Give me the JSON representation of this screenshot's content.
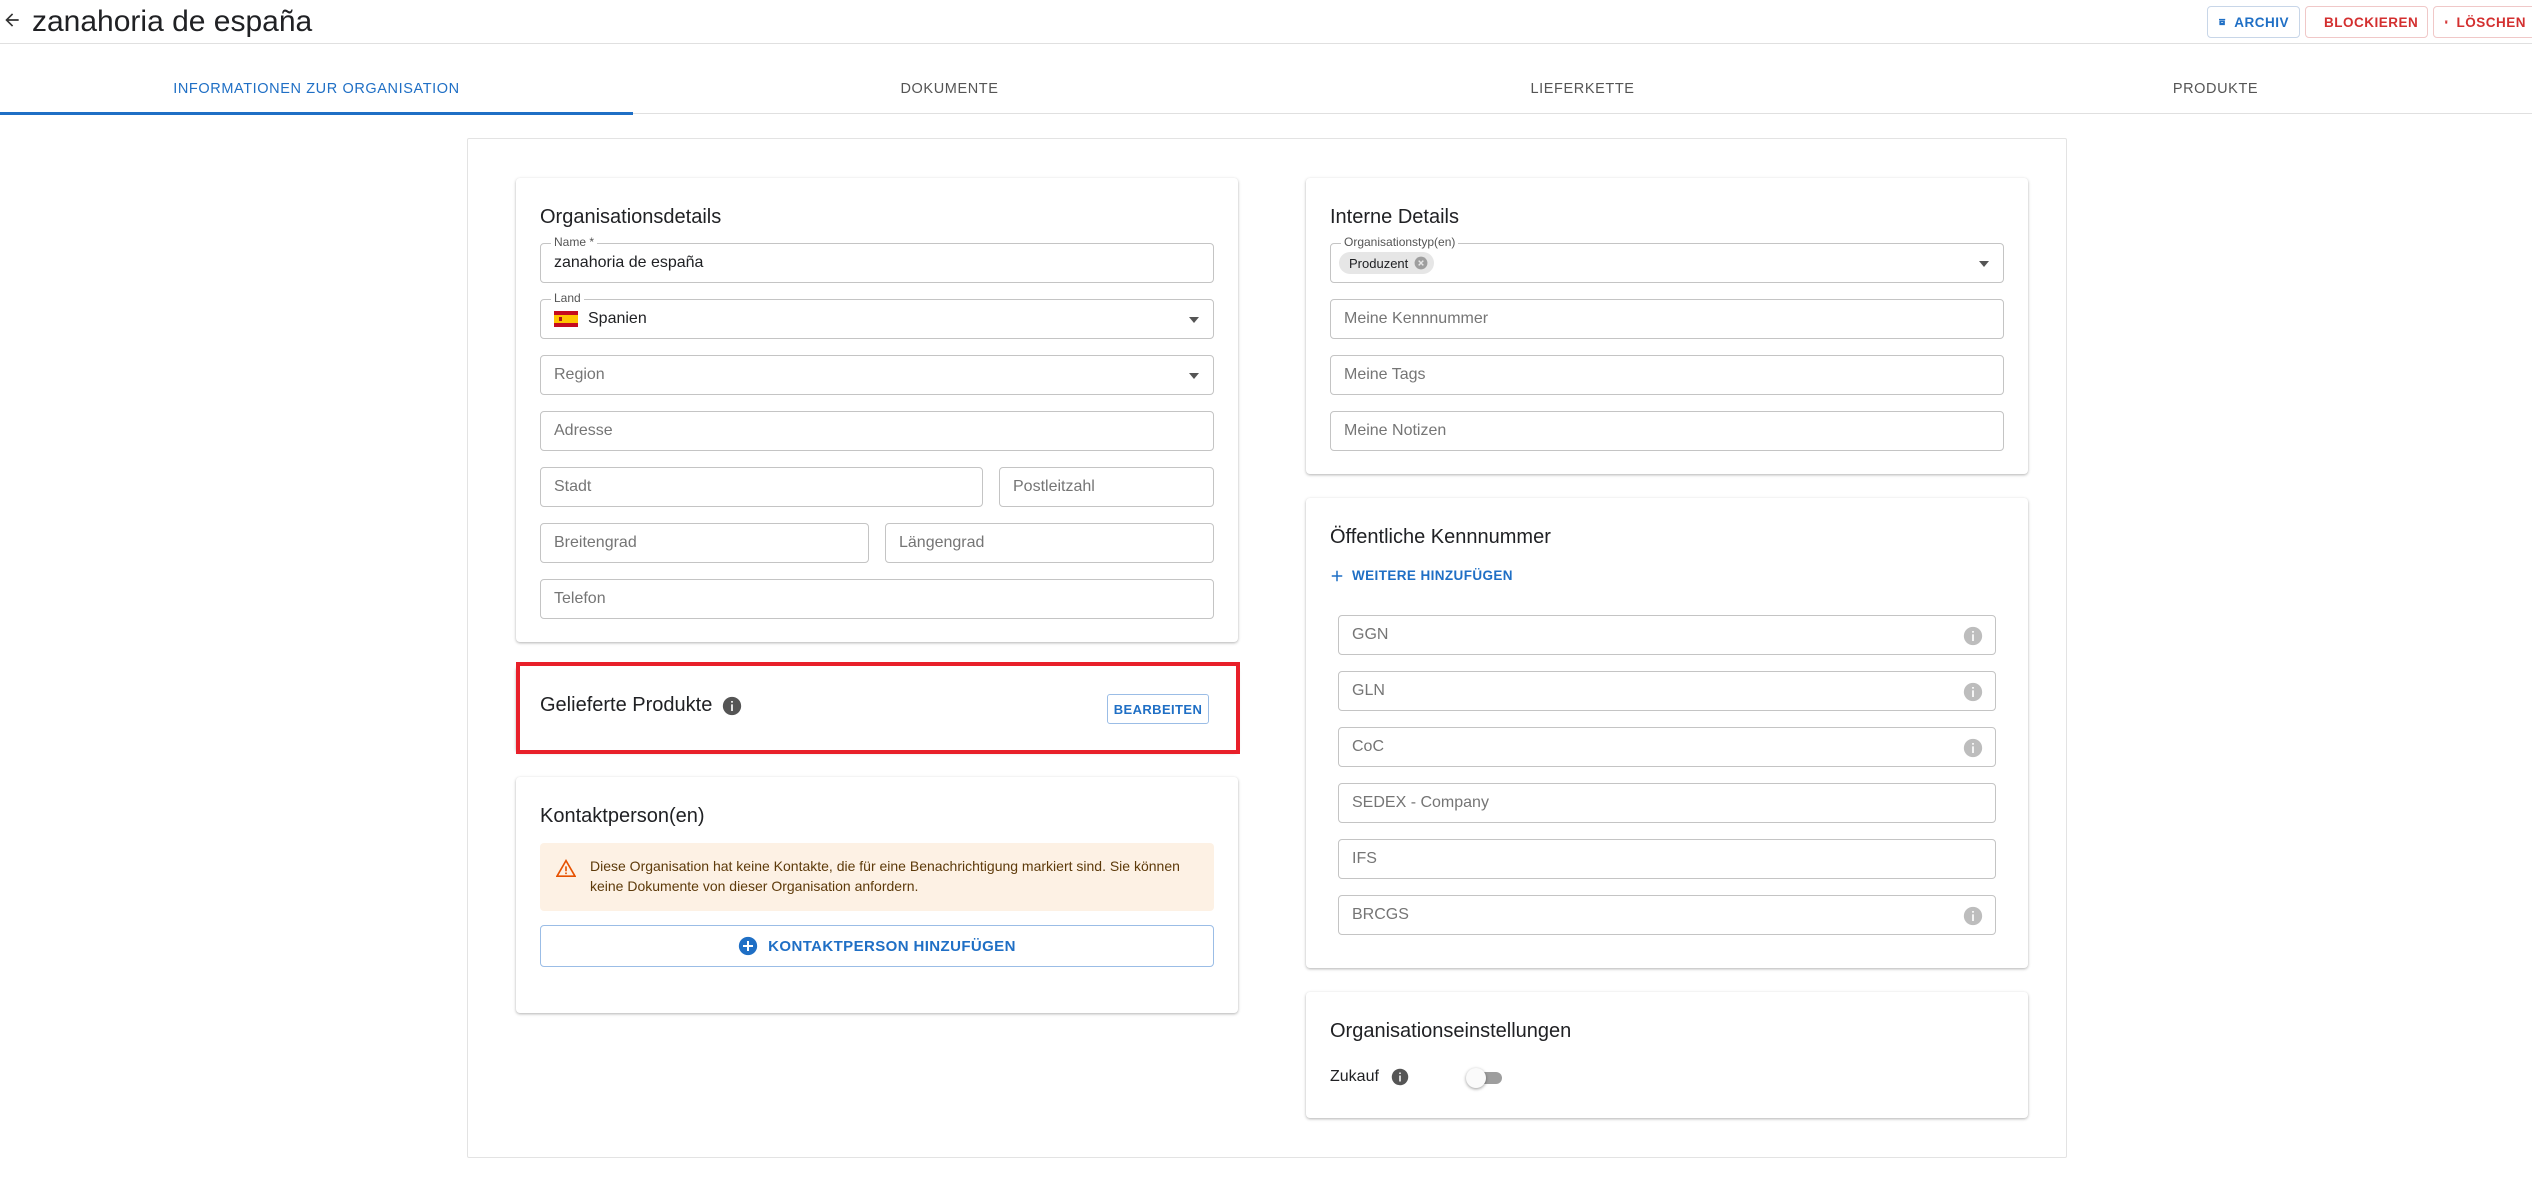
{
  "header": {
    "title": "zanahoria de españa",
    "buttons": {
      "archive": "ARCHIV",
      "block": "BLOCKIEREN",
      "delete": "LÖSCHEN"
    }
  },
  "tabs": [
    {
      "label": "INFORMATIONEN ZUR ORGANISATION",
      "active": true
    },
    {
      "label": "DOKUMENTE",
      "active": false
    },
    {
      "label": "LIEFERKETTE",
      "active": false
    },
    {
      "label": "PRODUKTE",
      "active": false
    }
  ],
  "org_details": {
    "title": "Organisationsdetails",
    "name_label": "Name *",
    "name_value": "zanahoria de españa",
    "country_label": "Land",
    "country_value": "Spanien",
    "region_placeholder": "Region",
    "address_placeholder": "Adresse",
    "city_placeholder": "Stadt",
    "zip_placeholder": "Postleitzahl",
    "lat_placeholder": "Breitengrad",
    "lng_placeholder": "Längengrad",
    "phone_placeholder": "Telefon"
  },
  "delivered_products": {
    "title": "Gelieferte Produkte",
    "edit_label": "BEARBEITEN"
  },
  "contacts": {
    "title": "Kontaktperson(en)",
    "warning_line1": "Diese Organisation hat keine Kontakte, die für eine Benachrichtigung markiert sind. Sie können",
    "warning_line2": "keine Dokumente von dieser Organisation anfordern.",
    "add_label": "KONTAKTPERSON HINZUFÜGEN"
  },
  "internal": {
    "title": "Interne Details",
    "type_label": "Organisationstyp(en)",
    "type_chip": "Produzent",
    "my_id_placeholder": "Meine Kennnummer",
    "my_tags_placeholder": "Meine Tags",
    "my_notes_placeholder": "Meine Notizen"
  },
  "public_ids": {
    "title": "Öffentliche Kennnummer",
    "add_more_label": "WEITERE HINZUFÜGEN",
    "fields": [
      "GGN",
      "GLN",
      "CoC",
      "SEDEX - Company",
      "IFS",
      "BRCGS"
    ]
  },
  "settings": {
    "title": "Organisationseinstellungen",
    "zukauf_label": "Zukauf",
    "zukauf_on": false
  },
  "colors": {
    "primary": "#1f6fc5",
    "danger": "#d32f2f",
    "highlight": "#e8202a",
    "warning_bg": "#fdf1e4"
  },
  "icons": {
    "back": "arrow-left-icon",
    "archive": "archive-box-icon",
    "block": "block-icon",
    "delete": "trash-icon",
    "info": "info-icon",
    "warning": "warning-triangle-icon",
    "add_circle": "plus-circle-icon",
    "plus": "plus-icon",
    "flag": "spain-flag-icon",
    "chip_remove": "chip-remove-icon"
  }
}
